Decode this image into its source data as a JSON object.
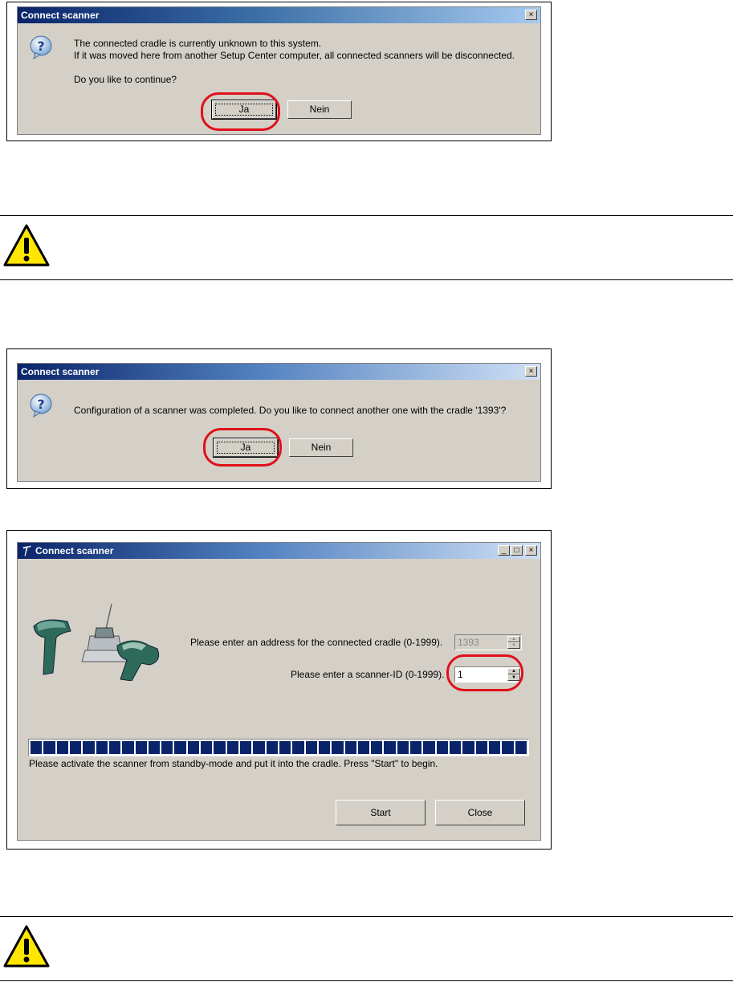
{
  "dialog1": {
    "title": "Connect scanner",
    "close_label": "×",
    "message_line1": "The connected cradle is currently unknown to this system.",
    "message_line2": "If it was moved here from another Setup Center computer, all connected scanners will be disconnected.",
    "message_line3": "Do you like to continue?",
    "yes_label": "Ja",
    "no_label": "Nein"
  },
  "dialog2": {
    "title": "Connect scanner",
    "close_label": "×",
    "message": "Configuration of a scanner was completed. Do you like to connect another one with the cradle '1393'?",
    "yes_label": "Ja",
    "no_label": "Nein"
  },
  "window3": {
    "title": "Connect scanner",
    "minimize_label": "_",
    "maximize_label": "□",
    "close_label": "×",
    "cradle_label": "Please enter an address for the connected cradle  (0-1999).",
    "cradle_value": "1393",
    "scanner_label": "Please enter a  scanner-ID (0-1999).",
    "scanner_value": "1",
    "progress_fraction": 1.0,
    "status_text": "Please activate the scanner from standby-mode and put it into the cradle. Press \"Start\" to begin.",
    "start_label": "Start",
    "close_button_label": "Close"
  },
  "colors": {
    "highlight_ring": "#e0101a",
    "titlebar": "#0a246a",
    "dialog_bg": "#d4d0c8"
  },
  "icons": {
    "question": "question-icon",
    "warning": "warning-icon"
  }
}
